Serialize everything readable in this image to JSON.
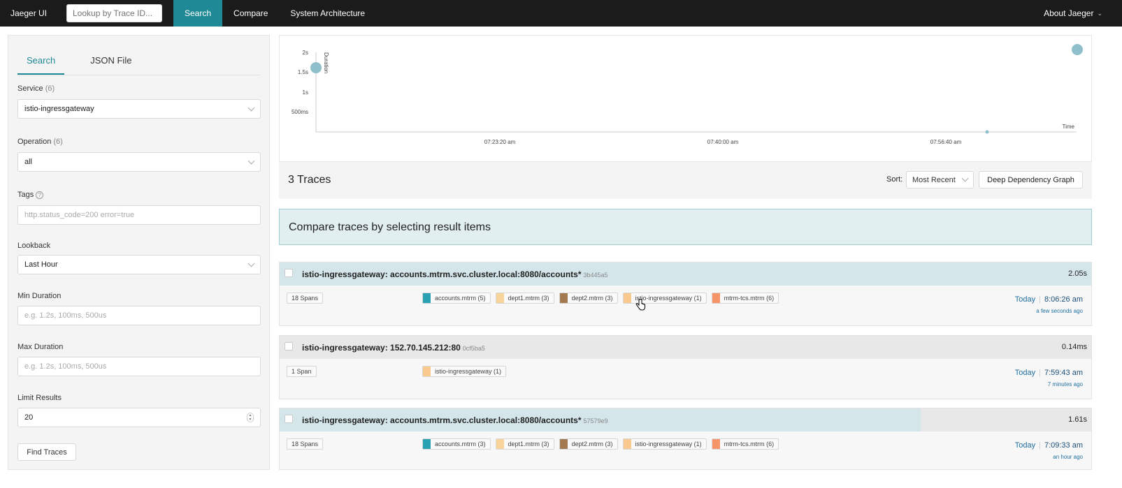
{
  "nav": {
    "brand": "Jaeger UI",
    "lookup_placeholder": "Lookup by Trace ID...",
    "links": [
      "Search",
      "Compare",
      "System Architecture"
    ],
    "about": "About Jaeger"
  },
  "left": {
    "tabs": [
      "Search",
      "JSON File"
    ],
    "service": {
      "label": "Service",
      "count": "(6)",
      "value": "istio-ingressgateway"
    },
    "operation": {
      "label": "Operation",
      "count": "(6)",
      "value": "all"
    },
    "tags": {
      "label": "Tags",
      "placeholder": "http.status_code=200 error=true"
    },
    "lookback": {
      "label": "Lookback",
      "value": "Last Hour"
    },
    "min_duration": {
      "label": "Min Duration",
      "placeholder": "e.g. 1.2s, 100ms, 500us"
    },
    "max_duration": {
      "label": "Max Duration",
      "placeholder": "e.g. 1.2s, 100ms, 500us"
    },
    "limit": {
      "label": "Limit Results",
      "value": "20"
    },
    "find_button": "Find Traces"
  },
  "chart_data": {
    "type": "scatter",
    "ylabel": "Duration",
    "xlabel": "Time",
    "y_ticks": [
      "2s",
      "1.5s",
      "1s",
      "500ms"
    ],
    "x_ticks": [
      "07:23:20 am",
      "07:40:00 am",
      "07:56:40 am"
    ]
  },
  "results": {
    "count_label": "3 Traces",
    "sort_label": "Sort:",
    "sort_value": "Most Recent",
    "ddg_button": "Deep Dependency Graph",
    "compare_banner": "Compare traces by selecting result items"
  },
  "colors": {
    "accounts": "#2aa1b3",
    "dept1": "#f7d59a",
    "dept2": "#a47a52",
    "ingress": "#f9c98f",
    "tcs": "#f79469",
    "accent": "#1f8a96"
  },
  "traces": [
    {
      "title": "istio-ingressgateway: accounts.mtrm.svc.cluster.local:8080/accounts*",
      "id": "3b445a5",
      "duration": "2.05s",
      "duration_fraction": 1.0,
      "spans": "18 Spans",
      "services": [
        "accounts.mtrm (5)",
        "dept1.mtrm (3)",
        "dept2.mtrm (3)",
        "istio-ingressgateway (1)",
        "mtrm-tcs.mtrm (6)"
      ],
      "day": "Today",
      "time": "8:06:26 am",
      "ago": "a few seconds ago"
    },
    {
      "title": "istio-ingressgateway: 152.70.145.212:80",
      "id": "0cf5ba5",
      "duration": "0.14ms",
      "duration_fraction": 0,
      "spans": "1 Span",
      "services": [
        "istio-ingressgateway (1)"
      ],
      "day": "Today",
      "time": "7:59:43 am",
      "ago": "7 minutes ago"
    },
    {
      "title": "istio-ingressgateway: accounts.mtrm.svc.cluster.local:8080/accounts*",
      "id": "57579e9",
      "duration": "1.61s",
      "duration_fraction": 0.79,
      "spans": "18 Spans",
      "services": [
        "accounts.mtrm (3)",
        "dept1.mtrm (3)",
        "dept2.mtrm (3)",
        "istio-ingressgateway (1)",
        "mtrm-tcs.mtrm (6)"
      ],
      "day": "Today",
      "time": "7:09:33 am",
      "ago": "an hour ago"
    }
  ]
}
